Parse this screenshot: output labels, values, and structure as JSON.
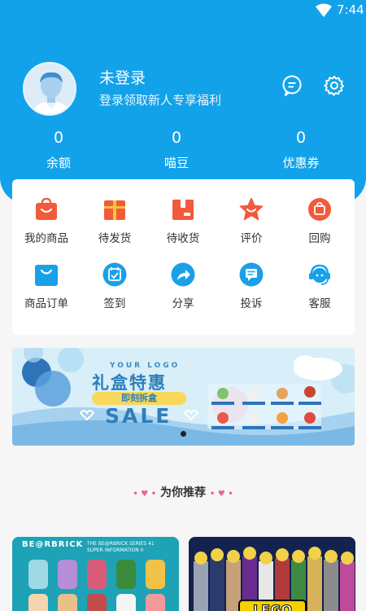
{
  "status_bar": {
    "time": "7:44",
    "wifi_icon": "wifi-icon"
  },
  "profile": {
    "name": "未登录",
    "subtitle": "登录领取新人专享福利",
    "avatar_icon": "avatar-icon",
    "message_icon": "message-icon",
    "settings_icon": "gear-icon"
  },
  "stats": [
    {
      "value": "0",
      "label": "余额"
    },
    {
      "value": "0",
      "label": "喵豆"
    },
    {
      "value": "0",
      "label": "优惠券"
    }
  ],
  "menu": [
    {
      "label": "我的商品",
      "icon": "shopping-bag-icon",
      "color": "#f15a3a"
    },
    {
      "label": "待发货",
      "icon": "gift-box-icon",
      "color": "#f15a3a"
    },
    {
      "label": "待收货",
      "icon": "package-icon",
      "color": "#f15a3a"
    },
    {
      "label": "评价",
      "icon": "star-icon",
      "color": "#f15a3a"
    },
    {
      "label": "回购",
      "icon": "repurchase-icon",
      "color": "#f15a3a"
    },
    {
      "label": "商品订单",
      "icon": "order-bag-icon",
      "color": "#1aa0e8"
    },
    {
      "label": "签到",
      "icon": "calendar-check-icon",
      "color": "#1aa0e8"
    },
    {
      "label": "分享",
      "icon": "share-icon",
      "color": "#1aa0e8"
    },
    {
      "label": "投诉",
      "icon": "complaint-icon",
      "color": "#1aa0e8"
    },
    {
      "label": "客服",
      "icon": "headset-icon",
      "color": "#1aa0e8"
    }
  ],
  "banner": {
    "logo": "YOUR LOGO",
    "title": "礼盒特惠",
    "pill": "即刻拆盒",
    "sale": "SALE"
  },
  "recommend": {
    "title": "为你推荐"
  },
  "products": [
    {
      "brand": "BE@RBRICK",
      "sub_line1": "THE BE@RBRICK SERIES 41",
      "sub_line2": "SUPER INFORMATION II"
    },
    {
      "brand": "LEGO"
    }
  ],
  "colors": {
    "primary": "#12a2ea",
    "accent_red": "#f15a3a",
    "accent_blue": "#1aa0e8"
  }
}
